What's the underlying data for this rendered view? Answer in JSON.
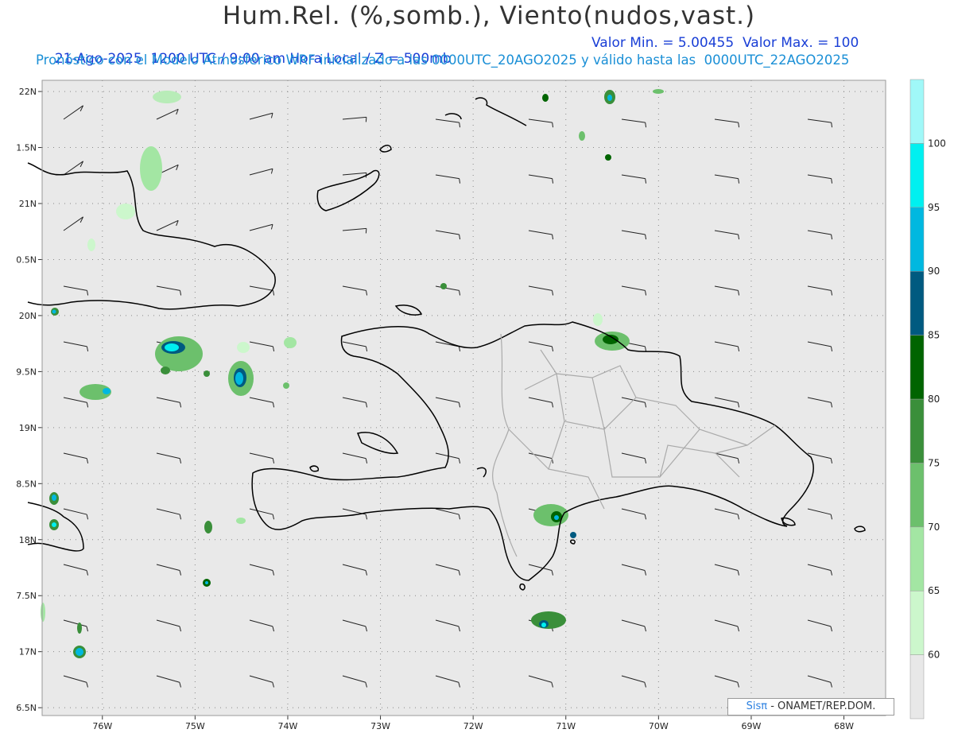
{
  "header": {
    "title": "Hum.Rel. (%,somb.), Viento(nudos,vast.)",
    "subtitle_left": "21-Ago-2025  1200 UTC / 9:00 am Hora Local / Z = 500mb",
    "subtitle_right": "Valor Min. = 5.00455  Valor Max. = 100",
    "model_line": "Pronóstico con el Modelo Atmosférico WRF inicializado a las 0000UTC_20AGO2025 y válido hasta las  0000UTC_22AGO2025"
  },
  "map": {
    "background": "#e9e9e9",
    "lat_labels": [
      "22N",
      "1.5N",
      "21N",
      "0.5N",
      "20N",
      "9.5N",
      "19N",
      "8.5N",
      "18N",
      "7.5N",
      "17N",
      "6.5N"
    ],
    "lat_values": [
      22,
      21.5,
      21,
      20.5,
      20,
      19.5,
      19,
      18.5,
      18,
      17.5,
      17,
      16.5
    ],
    "lon_labels": [
      "76W",
      "75W",
      "74W",
      "73W",
      "72W",
      "71W",
      "70W",
      "69W",
      "68W"
    ],
    "lon_values": [
      -76,
      -75,
      -74,
      -73,
      -72,
      -71,
      -70,
      -69,
      -68
    ]
  },
  "colorbar": {
    "levels": [
      "60",
      "65",
      "70",
      "75",
      "80",
      "85",
      "90",
      "95",
      "100"
    ],
    "colors": [
      "#e8e8e8",
      "#ccf7cc",
      "#a3e6a3",
      "#6cc06c",
      "#3a8f3a",
      "#006400",
      "#005a80",
      "#00b8e0",
      "#00f0f0",
      "#a0f8f8"
    ]
  },
  "credit": {
    "sis": "Sisπ",
    "org": "- ONAMET/REP.DOM."
  }
}
